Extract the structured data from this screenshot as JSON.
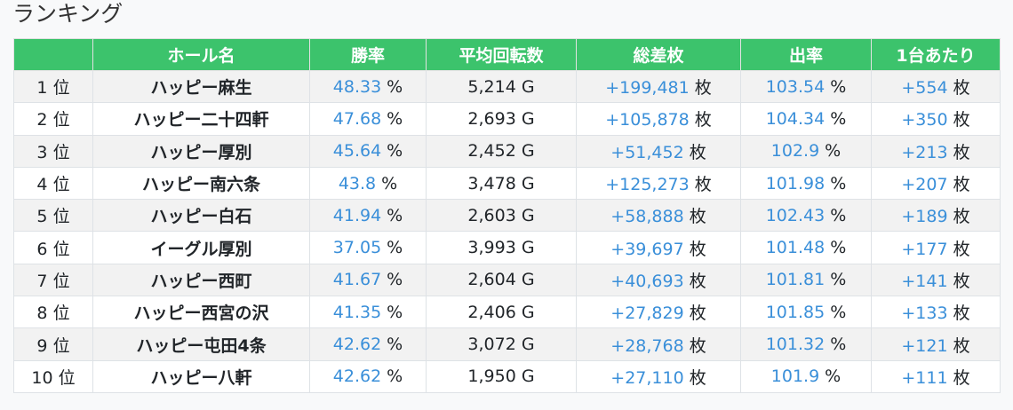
{
  "page_title": "ランキング",
  "table": {
    "headers": [
      "",
      "ホール名",
      "勝率",
      "平均回転数",
      "総差枚",
      "出率",
      "1台あたり"
    ],
    "rank_suffix": "位",
    "percent_unit": "%",
    "coin_unit": "枚",
    "rows": [
      {
        "rank": "1",
        "hall": "ハッピー麻生",
        "win_rate": "48.33",
        "avg_spins": "5,214 G",
        "total_diff": "+199,481",
        "payout": "103.54",
        "per_machine": "+554"
      },
      {
        "rank": "2",
        "hall": "ハッピー二十四軒",
        "win_rate": "47.68",
        "avg_spins": "2,693 G",
        "total_diff": "+105,878",
        "payout": "104.34",
        "per_machine": "+350"
      },
      {
        "rank": "3",
        "hall": "ハッピー厚別",
        "win_rate": "45.64",
        "avg_spins": "2,452 G",
        "total_diff": "+51,452",
        "payout": "102.9",
        "per_machine": "+213"
      },
      {
        "rank": "4",
        "hall": "ハッピー南六条",
        "win_rate": "43.8",
        "avg_spins": "3,478 G",
        "total_diff": "+125,273",
        "payout": "101.98",
        "per_machine": "+207"
      },
      {
        "rank": "5",
        "hall": "ハッピー白石",
        "win_rate": "41.94",
        "avg_spins": "2,603 G",
        "total_diff": "+58,888",
        "payout": "102.43",
        "per_machine": "+189"
      },
      {
        "rank": "6",
        "hall": "イーグル厚別",
        "win_rate": "37.05",
        "avg_spins": "3,993 G",
        "total_diff": "+39,697",
        "payout": "101.48",
        "per_machine": "+177"
      },
      {
        "rank": "7",
        "hall": "ハッピー西町",
        "win_rate": "41.67",
        "avg_spins": "2,604 G",
        "total_diff": "+40,693",
        "payout": "101.81",
        "per_machine": "+141"
      },
      {
        "rank": "8",
        "hall": "ハッピー西宮の沢",
        "win_rate": "41.35",
        "avg_spins": "2,406 G",
        "total_diff": "+27,829",
        "payout": "101.85",
        "per_machine": "+133"
      },
      {
        "rank": "9",
        "hall": "ハッピー屯田4条",
        "win_rate": "42.62",
        "avg_spins": "3,072 G",
        "total_diff": "+28,768",
        "payout": "101.32",
        "per_machine": "+121"
      },
      {
        "rank": "10",
        "hall": "ハッピー八軒",
        "win_rate": "42.62",
        "avg_spins": "1,950 G",
        "total_diff": "+27,110",
        "payout": "101.9",
        "per_machine": "+111"
      }
    ]
  },
  "colors": {
    "header_bg": "#3cc36c",
    "value_blue": "#3a8fd9"
  }
}
